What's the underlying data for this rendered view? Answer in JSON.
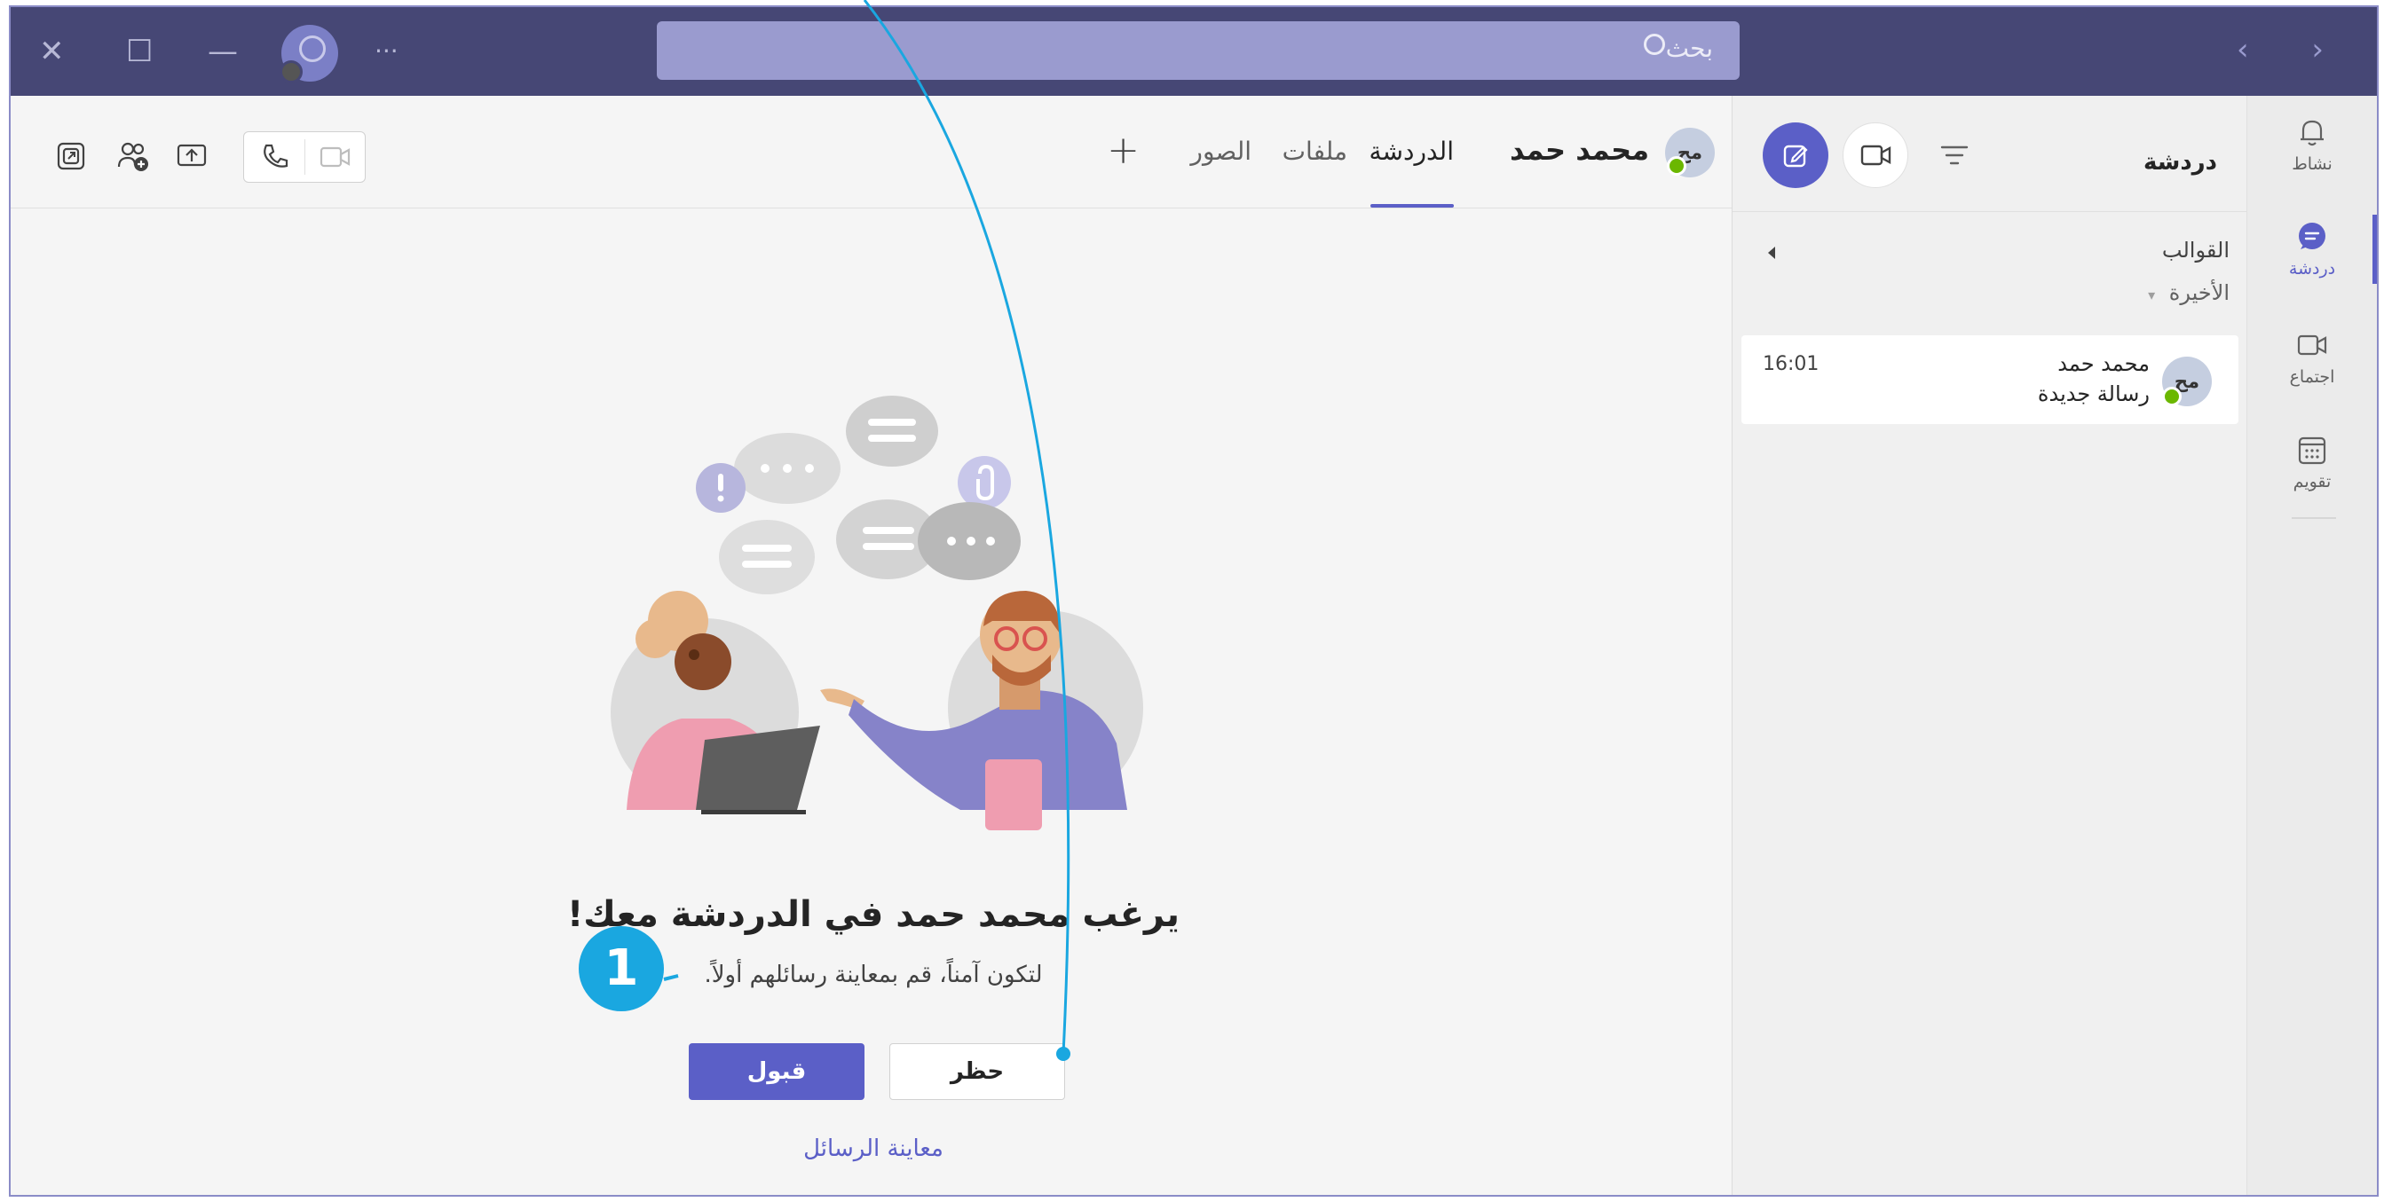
{
  "titlebar": {
    "search_placeholder": "بحث",
    "more_label": "···",
    "close_glyph": "✕",
    "maximize_glyph": "☐",
    "minimize_glyph": "—",
    "nav_glyphs": "‹ ›"
  },
  "rail": {
    "items": [
      {
        "label": "نشاط",
        "icon": "bell-icon"
      },
      {
        "label": "دردشة",
        "icon": "chat-icon"
      },
      {
        "label": "اجتماع",
        "icon": "video-icon"
      },
      {
        "label": "تقويم",
        "icon": "calendar-icon"
      }
    ]
  },
  "chat_list": {
    "title": "دردشة",
    "sections": {
      "templates": "القوالب",
      "recent": "الأخيرة"
    },
    "items": [
      {
        "initials": "مح",
        "name": "محمد حمد",
        "preview": "رسالة جديدة",
        "time": "16:01"
      }
    ]
  },
  "conversation": {
    "avatar_initials": "مح",
    "name": "محمد حمد",
    "tabs": [
      "الدردشة",
      "ملفات",
      "الصور"
    ],
    "add_tab": "+",
    "invite_title": "يرغب محمد حمد في الدردشة معك!",
    "invite_subtitle": "لتكون آمناً، قم بمعاينة رسائلهم أولاً.",
    "accept_label": "قبول",
    "block_label": "حظر",
    "preview_label": "معاينة الرسائل"
  },
  "callouts": {
    "step": "1",
    "color": "#1aa7e0"
  },
  "colors": {
    "titlebar": "#464775",
    "accent": "#5b5fc7",
    "search": "#9a9bcf",
    "presence": "#6bb700"
  }
}
